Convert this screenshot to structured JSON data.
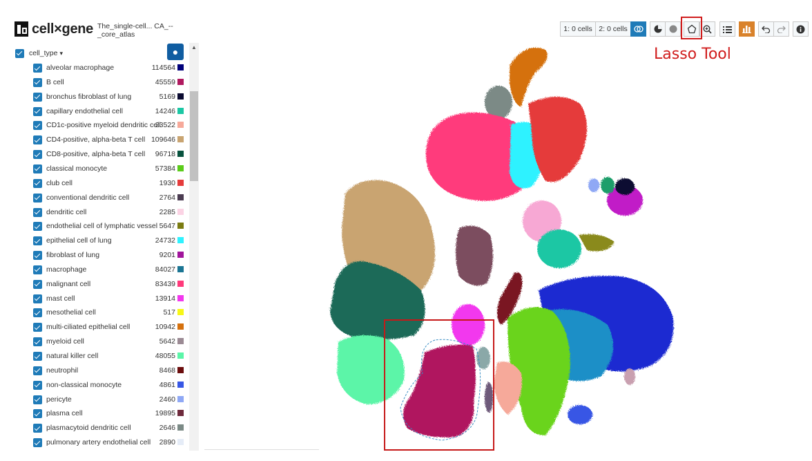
{
  "app": {
    "brand": "cell×gene",
    "dataset": "The_single-cell... CA_--_core_atlas"
  },
  "category": {
    "name": "cell_type",
    "chevron": "▾"
  },
  "cell_types": [
    {
      "label": "alveolar macrophage",
      "count": "114564",
      "color": "#00007a"
    },
    {
      "label": "B cell",
      "count": "45559",
      "color": "#b0195f"
    },
    {
      "label": "bronchus fibroblast of lung",
      "count": "5169",
      "color": "#0a0a30"
    },
    {
      "label": "capillary endothelial cell",
      "count": "14246",
      "color": "#1bc7a4"
    },
    {
      "label": "CD1c-positive myeloid dendritic cell",
      "count": "23522",
      "color": "#f6a99a"
    },
    {
      "label": "CD4-positive, alpha-beta T cell",
      "count": "109646",
      "color": "#c9a471"
    },
    {
      "label": "CD8-positive, alpha-beta T cell",
      "count": "96718",
      "color": "#08523e"
    },
    {
      "label": "classical monocyte",
      "count": "57384",
      "color": "#5bcc1a"
    },
    {
      "label": "club cell",
      "count": "1930",
      "color": "#e53b3b"
    },
    {
      "label": "conventional dendritic cell",
      "count": "2764",
      "color": "#4b3c52"
    },
    {
      "label": "dendritic cell",
      "count": "2285",
      "color": "#fbd3e4"
    },
    {
      "label": "endothelial cell of lymphatic vessel",
      "count": "5647",
      "color": "#7b7c12"
    },
    {
      "label": "epithelial cell of lung",
      "count": "24732",
      "color": "#2ff2ff"
    },
    {
      "label": "fibroblast of lung",
      "count": "9201",
      "color": "#a1159b"
    },
    {
      "label": "macrophage",
      "count": "84027",
      "color": "#1b7593"
    },
    {
      "label": "malignant cell",
      "count": "83439",
      "color": "#ff3a7b"
    },
    {
      "label": "mast cell",
      "count": "13914",
      "color": "#f238ee"
    },
    {
      "label": "mesothelial cell",
      "count": "517",
      "color": "#f7f717"
    },
    {
      "label": "multi-ciliated epithelial cell",
      "count": "10942",
      "color": "#d5710e"
    },
    {
      "label": "myeloid cell",
      "count": "5642",
      "color": "#9b8a94"
    },
    {
      "label": "natural killer cell",
      "count": "48055",
      "color": "#5bf5a8"
    },
    {
      "label": "neutrophil",
      "count": "8468",
      "color": "#6b0d0d"
    },
    {
      "label": "non-classical monocyte",
      "count": "4861",
      "color": "#3757e5"
    },
    {
      "label": "pericyte",
      "count": "2460",
      "color": "#8fa8f5"
    },
    {
      "label": "plasma cell",
      "count": "19895",
      "color": "#6e2a3c"
    },
    {
      "label": "plasmacytoid dendritic cell",
      "count": "2646",
      "color": "#7b8a86"
    },
    {
      "label": "pulmonary artery endothelial cell",
      "count": "2890",
      "color": "#e5ecf7"
    }
  ],
  "toolbar": {
    "set1": "1: 0 cells",
    "set2": "2: 0 cells"
  },
  "annotation": {
    "lasso_label": "Lasso Tool"
  }
}
